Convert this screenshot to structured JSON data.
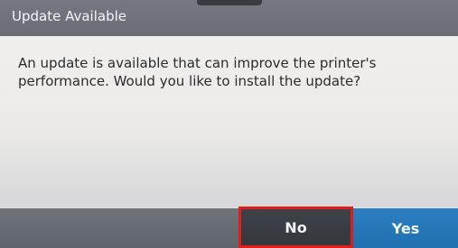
{
  "dialog": {
    "title": "Update Available",
    "message": "An update is available that can improve the printer's\nperformance. Would you like to install the update?"
  },
  "buttons": {
    "no_label": "No",
    "yes_label": "Yes"
  },
  "colors": {
    "title_bar": "#6f737a",
    "no_button_background": "#3a3d42",
    "no_button_highlight_border": "#e21b1b",
    "yes_button_background": "#2577b8"
  }
}
